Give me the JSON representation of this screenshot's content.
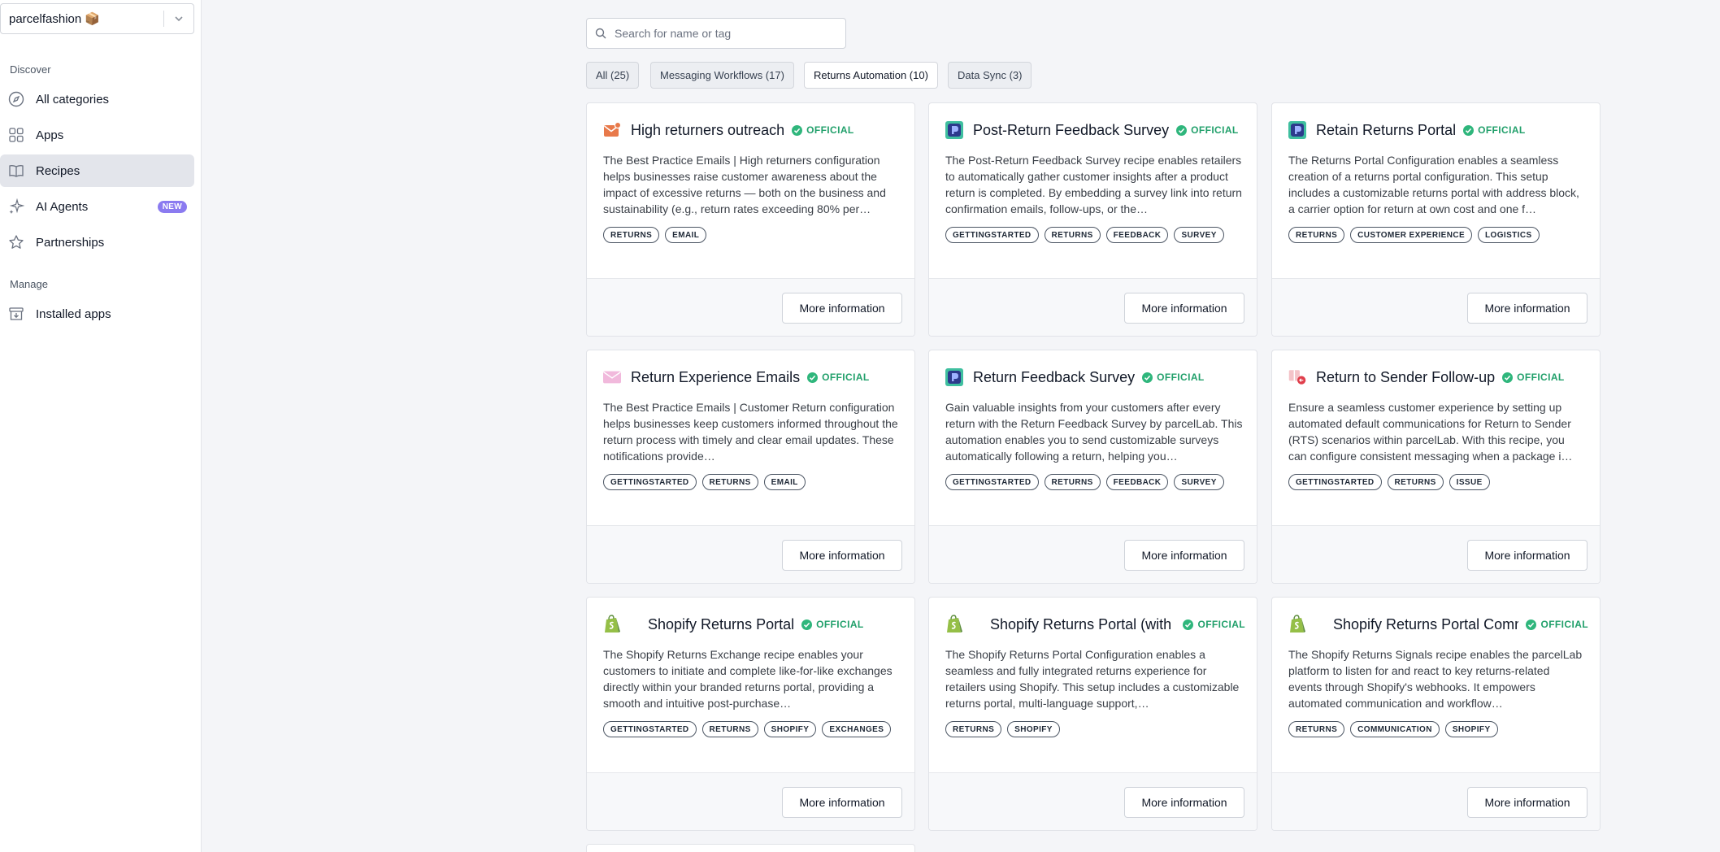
{
  "org": {
    "name": "parcelfashion 📦"
  },
  "sidebar": {
    "discover_label": "Discover",
    "manage_label": "Manage",
    "items": [
      {
        "label": "All categories",
        "icon": "compass-icon"
      },
      {
        "label": "Apps",
        "icon": "grid-icon"
      },
      {
        "label": "Recipes",
        "icon": "book-icon",
        "active": true
      },
      {
        "label": "AI Agents",
        "icon": "sparkle-icon",
        "badge": "NEW"
      },
      {
        "label": "Partnerships",
        "icon": "star-icon"
      }
    ],
    "manage_items": [
      {
        "label": "Installed apps",
        "icon": "archive-download-icon"
      }
    ]
  },
  "search": {
    "placeholder": "Search for name or tag",
    "value": ""
  },
  "filters": [
    {
      "label": "All (25)"
    },
    {
      "label": "Messaging Workflows (17)"
    },
    {
      "label": "Returns Automation (10)",
      "active": true
    },
    {
      "label": "Data Sync (3)"
    }
  ],
  "official_label": "OFFICIAL",
  "more_info_label": "More information",
  "cards": [
    {
      "title": "High returners outreach",
      "icon": "email-icon",
      "description": "The Best Practice Emails | High returners configuration helps businesses raise customer awareness about the impact of excessive returns — both on the business and sustainability (e.g., return rates exceeding 80% per…",
      "tags": [
        "RETURNS",
        "EMAIL"
      ]
    },
    {
      "title": "Post-Return Feedback Survey",
      "icon": "parcellab-icon",
      "description": "The Post-Return Feedback Survey recipe enables retailers to automatically gather customer insights after a product return is completed. By embedding a survey link into return confirmation emails, follow-ups, or the…",
      "tags": [
        "GETTINGSTARTED",
        "RETURNS",
        "FEEDBACK",
        "SURVEY"
      ]
    },
    {
      "title": "Retain Returns Portal",
      "icon": "parcellab-icon",
      "description": "The Returns Portal Configuration enables a seamless creation of a returns portal configuration. This setup includes a customizable returns portal with address block, a carrier option for return at own cost and one f…",
      "tags": [
        "RETURNS",
        "CUSTOMER EXPERIENCE",
        "LOGISTICS"
      ]
    },
    {
      "title": "Return Experience Emails",
      "icon": "envelope-icon",
      "description": "The Best Practice Emails | Customer Return configuration helps businesses keep customers informed throughout the return process with timely and clear email updates. These notifications provide…",
      "tags": [
        "GETTINGSTARTED",
        "RETURNS",
        "EMAIL"
      ]
    },
    {
      "title": "Return Feedback Survey",
      "icon": "parcellab-icon",
      "description": "Gain valuable insights from your customers after every return with the Return Feedback Survey by parcelLab. This automation enables you to send customizable surveys automatically following a return, helping you…",
      "tags": [
        "GETTINGSTARTED",
        "RETURNS",
        "FEEDBACK",
        "SURVEY"
      ]
    },
    {
      "title": "Return to Sender Follow-up",
      "icon": "return-package-icon",
      "description": "Ensure a seamless customer experience by setting up automated default communications for Return to Sender (RTS) scenarios within parcelLab. With this recipe, you can configure consistent messaging when a package i…",
      "tags": [
        "GETTINGSTARTED",
        "RETURNS",
        "ISSUE"
      ]
    },
    {
      "title": "Shopify Returns Portal",
      "icon": "shopify-icon",
      "description": "The Shopify Returns Exchange recipe enables your customers to initiate and complete like-for-like exchanges directly within your branded returns portal, providing a smooth and intuitive post-purchase…",
      "tags": [
        "GETTINGSTARTED",
        "RETURNS",
        "SHOPIFY",
        "EXCHANGES"
      ]
    },
    {
      "title": "Shopify Returns Portal (with Exchange)",
      "icon": "shopify-icon",
      "description": "The Shopify Returns Portal Configuration enables a seamless and fully integrated returns experience for retailers using Shopify. This setup includes a customizable returns portal, multi-language support,…",
      "tags": [
        "RETURNS",
        "SHOPIFY"
      ]
    },
    {
      "title": "Shopify Returns Portal Communication",
      "icon": "shopify-icon",
      "description": "The Shopify Returns Signals recipe enables the parcelLab platform to listen for and react to key returns-related events through Shopify's webhooks. It empowers automated communication and workflow…",
      "tags": [
        "RETURNS",
        "COMMUNICATION",
        "SHOPIFY"
      ]
    }
  ],
  "colors": {
    "accent_green": "#2fb67c",
    "badge_purple": "#8b7bf0",
    "active_nav_bg": "#e3e5eb"
  }
}
